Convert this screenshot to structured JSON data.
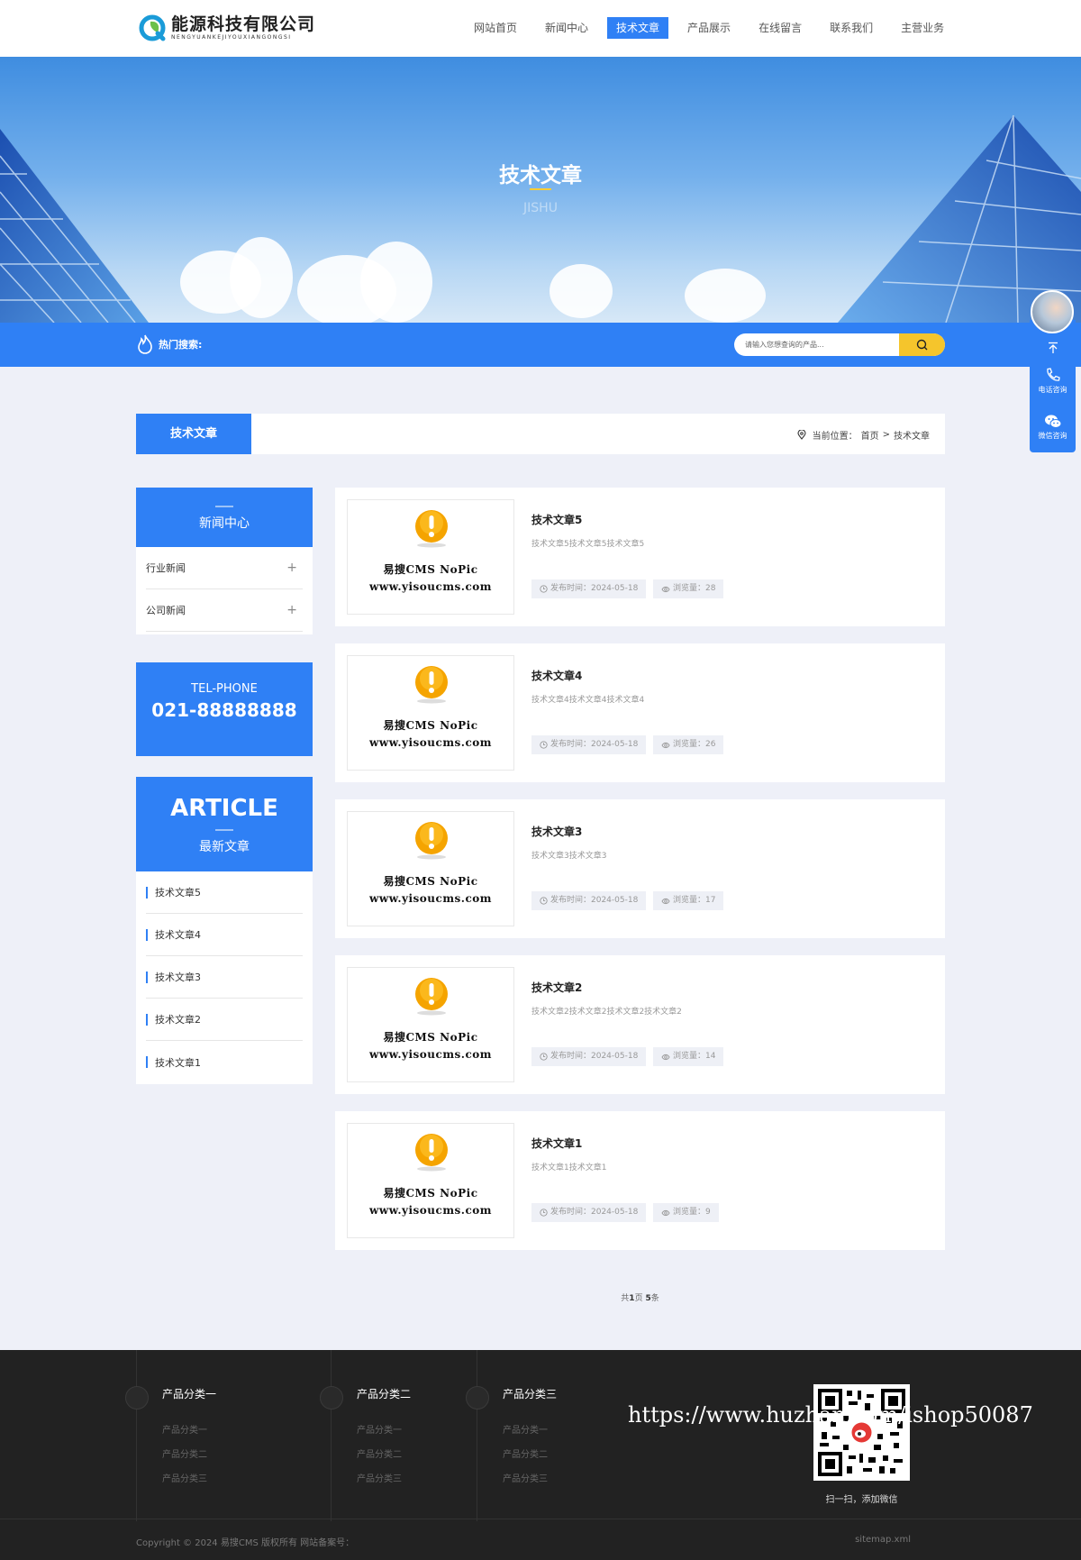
{
  "site": {
    "name": "能源科技有限公司",
    "name_en": "NENGYUANKEJIYOUXIANGONGSI"
  },
  "nav": {
    "items": [
      "网站首页",
      "新闻中心",
      "技术文章",
      "产品展示",
      "在线留言",
      "联系我们",
      "主营业务"
    ],
    "active_index": 2
  },
  "banner": {
    "title": "技术文章",
    "subtitle": "JISHU"
  },
  "search": {
    "hot_label": "热门搜索:",
    "placeholder": "请输入您想查询的产品..."
  },
  "breadcrumb": {
    "tab": "技术文章",
    "prefix": "当前位置：",
    "home": "首页",
    "sep": ">",
    "current": "技术文章"
  },
  "sidebar": {
    "news_title": "新闻中心",
    "news_categories": [
      "行业新闻",
      "公司新闻"
    ],
    "plus": "+",
    "tel_label": "TEL-PHONE",
    "tel_number": "021-88888888",
    "article_title_en": "ARTICLE",
    "article_title_cn": "最新文章",
    "latest": [
      "技术文章5",
      "技术文章4",
      "技术文章3",
      "技术文章2",
      "技术文章1"
    ]
  },
  "articles": [
    {
      "title": "技术文章5",
      "desc": "技术文章5技术文章5技术文章5",
      "date": "发布时间：2024-05-18",
      "views": "浏览量：28"
    },
    {
      "title": "技术文章4",
      "desc": "技术文章4技术文章4技术文章4",
      "date": "发布时间：2024-05-18",
      "views": "浏览量：26"
    },
    {
      "title": "技术文章3",
      "desc": "技术文章3技术文章3",
      "date": "发布时间：2024-05-18",
      "views": "浏览量：17"
    },
    {
      "title": "技术文章2",
      "desc": "技术文章2技术文章2技术文章2技术文章2",
      "date": "发布时间：2024-05-18",
      "views": "浏览量：14"
    },
    {
      "title": "技术文章1",
      "desc": "技术文章1技术文章1",
      "date": "发布时间：2024-05-18",
      "views": "浏览量：9"
    }
  ],
  "thumb": {
    "line1": "易搜CMS NoPic",
    "line2": "www.yisoucms.com"
  },
  "pager": {
    "pre": "共",
    "pages": "1",
    "mid": "页 ",
    "count": "5",
    "post": "条"
  },
  "footer": {
    "columns": [
      {
        "title": "产品分类一",
        "items": [
          "产品分类一",
          "产品分类二",
          "产品分类三"
        ]
      },
      {
        "title": "产品分类二",
        "items": [
          "产品分类一",
          "产品分类二",
          "产品分类三"
        ]
      },
      {
        "title": "产品分类三",
        "items": [
          "产品分类一",
          "产品分类二",
          "产品分类三"
        ]
      }
    ],
    "qr_label": "扫一扫，添加微信",
    "watermark": "https://www.huzhan.com/ishop50087",
    "copyright": "Copyright © 2024 易搜CMS 版权所有    网站备案号：",
    "sitemap": "sitemap.xml"
  },
  "floatbar": {
    "phone_label": "电话咨询",
    "wechat_label": "微信咨询"
  },
  "colors": {
    "primary": "#2f80f5",
    "accent": "#f5c52c",
    "footer": "#222222",
    "page_bg": "#eef0f8"
  }
}
